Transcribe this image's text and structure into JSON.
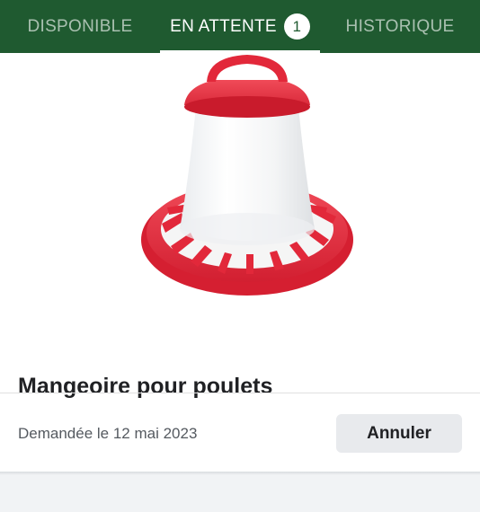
{
  "tabs": [
    {
      "label": "DISPONIBLE",
      "active": false
    },
    {
      "label": "EN ATTENTE",
      "active": true,
      "badge": "1"
    },
    {
      "label": "HISTORIQUE",
      "active": false
    }
  ],
  "item": {
    "title": "Mangeoire pour poulets",
    "image_icon": "chicken-feeder-image",
    "requested_text": "Demandée le 12 mai 2023",
    "cancel_label": "Annuler"
  },
  "colors": {
    "header_green": "#1f5a30",
    "feeder_red": "#e2283a",
    "button_gray": "#e8eaed"
  }
}
